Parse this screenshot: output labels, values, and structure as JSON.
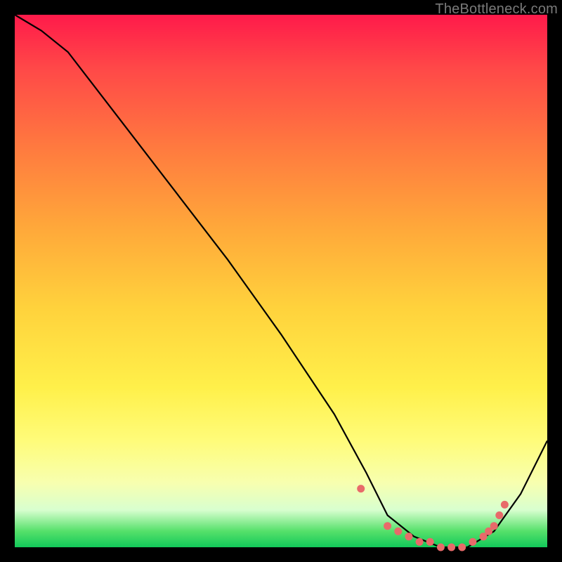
{
  "watermark": "TheBottleneck.com",
  "colors": {
    "background": "#000000",
    "gradient_top": "#ff1a4a",
    "gradient_bottom": "#12c95a",
    "curve": "#000000",
    "dots": "#e86a6a"
  },
  "chart_data": {
    "type": "line",
    "title": "",
    "xlabel": "",
    "ylabel": "",
    "xlim": [
      0,
      100
    ],
    "ylim": [
      0,
      100
    ],
    "series": [
      {
        "name": "bottleneck-curve",
        "x": [
          0,
          5,
          10,
          20,
          30,
          40,
          50,
          60,
          66,
          70,
          75,
          80,
          85,
          90,
          95,
          100
        ],
        "values": [
          100,
          97,
          93,
          80,
          67,
          54,
          40,
          25,
          14,
          6,
          2,
          0,
          0,
          3,
          10,
          20
        ]
      }
    ],
    "markers": {
      "name": "bottleneck-dots",
      "x": [
        65,
        70,
        72,
        74,
        76,
        78,
        80,
        82,
        84,
        86,
        88,
        89,
        90,
        91,
        92
      ],
      "values": [
        11,
        4,
        3,
        2,
        1,
        1,
        0,
        0,
        0,
        1,
        2,
        3,
        4,
        6,
        8
      ]
    }
  }
}
